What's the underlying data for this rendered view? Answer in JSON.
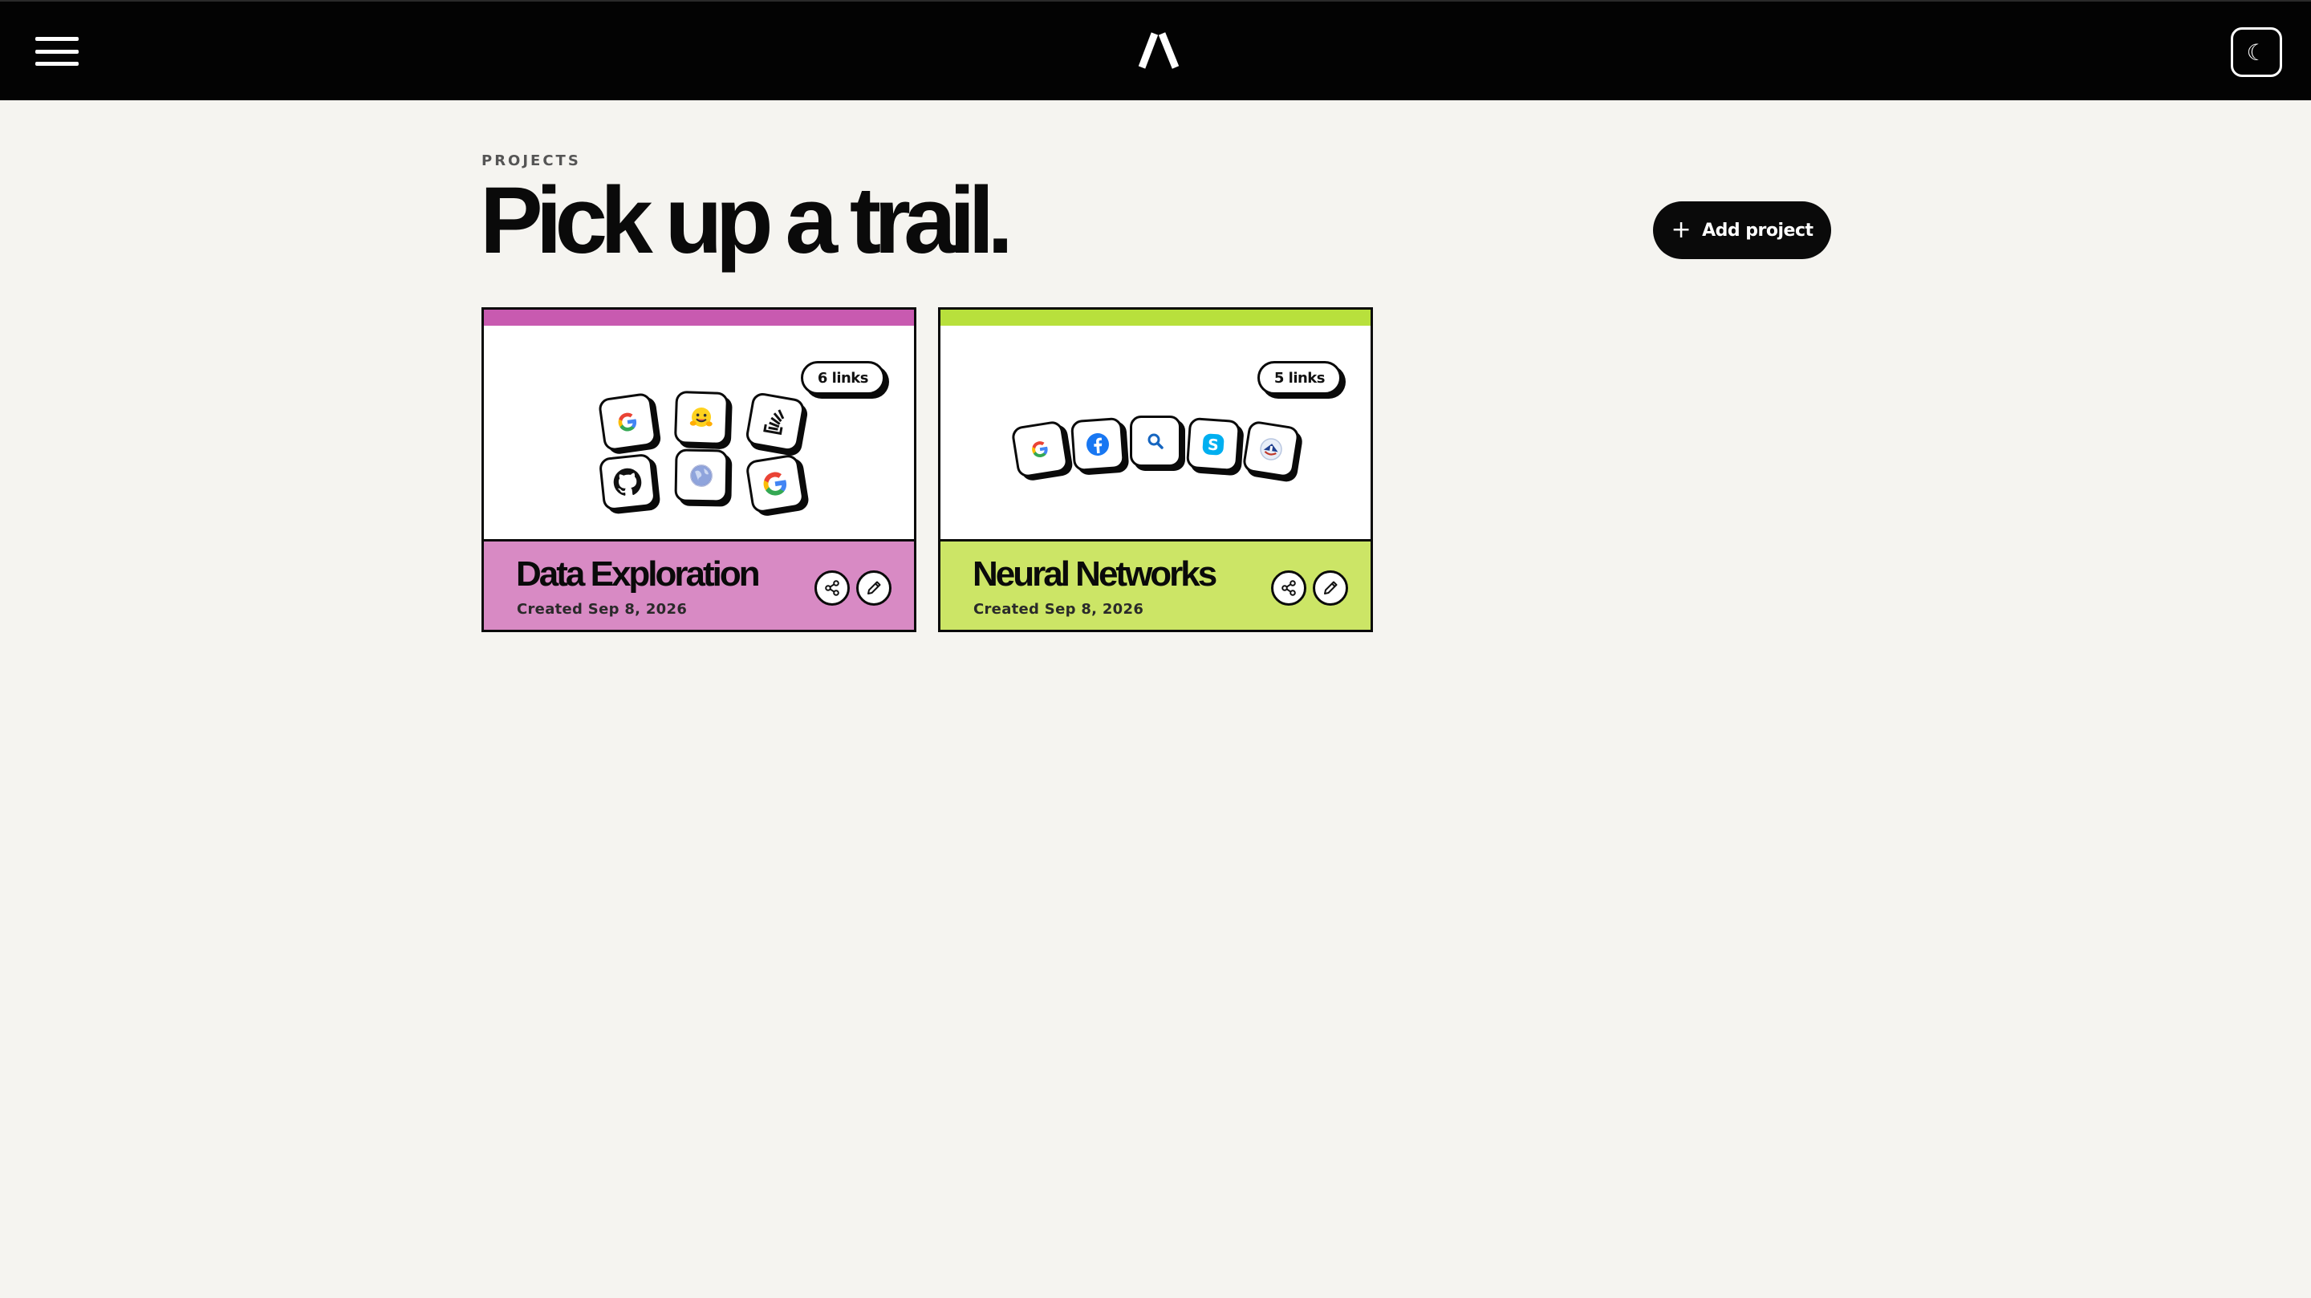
{
  "header": {
    "eyebrow": "PROJECTS",
    "title": "Pick up a trail.",
    "add_button_label": "Add project",
    "theme_toggle_symbol": "☾"
  },
  "colors": {
    "topbar": "#030303",
    "background": "#f5f4f0",
    "card1_stripe": "#c85ab0",
    "card1_footer": "#d88ac4",
    "card2_stripe": "#b8e03c",
    "card2_footer": "#cce566"
  },
  "projects": [
    {
      "name": "Data Exploration",
      "created": "Created Sep 8, 2026",
      "link_count": "6 links",
      "link_icons": [
        "google-icon",
        "huggingface-icon",
        "stackoverflow-icon",
        "github-icon",
        "globe-icon",
        "google-icon"
      ]
    },
    {
      "name": "Neural Networks",
      "created": "Created Sep 8, 2026",
      "link_count": "5 links",
      "link_icons": [
        "google-icon",
        "facebook-icon",
        "search-icon",
        "skype-icon",
        "site-icon"
      ]
    }
  ]
}
